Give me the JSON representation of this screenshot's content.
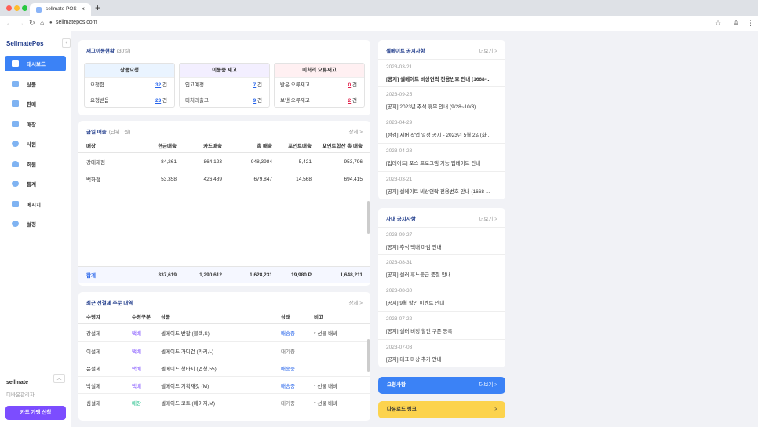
{
  "browser": {
    "tab_title": "sellmate POS",
    "url": "sellmatepos.com"
  },
  "sidebar": {
    "logo": "SellmatePos",
    "collapse_icon": "‹",
    "items": [
      {
        "label": "대시보드",
        "icon": "monitor-icon",
        "active": true
      },
      {
        "label": "상품",
        "icon": "box-icon"
      },
      {
        "label": "판매",
        "icon": "cart-icon"
      },
      {
        "label": "매장",
        "icon": "store-icon"
      },
      {
        "label": "사원",
        "icon": "employee-icon"
      },
      {
        "label": "회원",
        "icon": "member-icon"
      },
      {
        "label": "통계",
        "icon": "chart-icon"
      },
      {
        "label": "메시지",
        "icon": "mail-icon"
      },
      {
        "label": "설정",
        "icon": "gear-icon"
      }
    ],
    "user_name": "sellmate",
    "user_role": "디바운관리자",
    "card_button": "카드 가맹 신청"
  },
  "inventory": {
    "title": "재고이동현황",
    "sub": "(30일)",
    "boxes": [
      {
        "title": "상품요청",
        "rows": [
          {
            "label": "요청함",
            "value": "32",
            "unit": "건"
          },
          {
            "label": "요청받음",
            "value": "23",
            "unit": "건"
          }
        ]
      },
      {
        "title": "이동중 재고",
        "rows": [
          {
            "label": "입고예정",
            "value": "7",
            "unit": "건"
          },
          {
            "label": "미처리출고",
            "value": "9",
            "unit": "건"
          }
        ]
      },
      {
        "title": "미처리 오류재고",
        "rows": [
          {
            "label": "받은 오류재고",
            "value": "0",
            "unit": "건"
          },
          {
            "label": "보낸 오류재고",
            "value": "2",
            "unit": "건"
          }
        ]
      }
    ]
  },
  "sales": {
    "title": "금일 매출",
    "sub": "(단위 : 원)",
    "more": "상세 >",
    "headers": [
      "매장",
      "현금매출",
      "카드매출",
      "총 매출",
      "포인트매출",
      "포인트합산 총 매출"
    ],
    "rows": [
      [
        "강대제점",
        "84,261",
        "864,123",
        "948,3984",
        "5,421",
        "953,796"
      ],
      [
        "백화점",
        "53,358",
        "426,489",
        "679,847",
        "14,568",
        "694,415"
      ]
    ],
    "total": [
      "합계",
      "337,619",
      "1,290,612",
      "1,628,231",
      "19,980 P",
      "1,648,211"
    ]
  },
  "orders": {
    "title": "최근 선결제 주문 내역",
    "more": "상세 >",
    "headers": [
      "수령자",
      "수령구분",
      "상품",
      "상태",
      "비고"
    ],
    "rows": [
      [
        "강설제",
        "택배",
        "셀메이드 반팔 (블랙,S)",
        "배송중",
        "* 선물 배바"
      ],
      [
        "이설제",
        "택배",
        "셀메이드 가디건 (카키,L)",
        "대기중",
        ""
      ],
      [
        "문설제",
        "택배",
        "셀메이드 청바지 (연청,55)",
        "배송중",
        ""
      ],
      [
        "박설제",
        "택배",
        "셀메이드 기획재킷 (M)",
        "배송중",
        "* 선물 배바"
      ],
      [
        "심설제",
        "매장",
        "셀메이드 코트 (베이지,M)",
        "대기중",
        "* 선물 배바"
      ]
    ]
  },
  "notices": {
    "title": "셀메이트 공지사항",
    "more": "더보기 >",
    "items": [
      {
        "date": "2023-03-21",
        "text": "[공지] 셀메이트 비상연락 전용번호 안내 (1668-...",
        "bold": true
      },
      {
        "date": "2023-09-25",
        "text": "[공지] 2023년 추석 휴무 안내 (9/28~10/3)"
      },
      {
        "date": "2023-04-29",
        "text": "[점검] 서버 작업 일정 공지 - 2023년 5월 2일(화..."
      },
      {
        "date": "2023-04-28",
        "text": "[업데이트] 포스 프로그램 기능 업데이트 안내"
      },
      {
        "date": "2023-03-21",
        "text": "[공지] 셀메이트 비상연락 전용번호 안내 (1668-..."
      }
    ]
  },
  "internal": {
    "title": "사내 공지사항",
    "more": "더보기 >",
    "items": [
      {
        "date": "2023-09-27",
        "text": "[공지] 추석 택배 마감 안내"
      },
      {
        "date": "2023-08-31",
        "text": "[공지] 셀러 후느등급 품절 안내"
      },
      {
        "date": "2023-08-30",
        "text": "[공지] 9월 할인 이벤트 안내"
      },
      {
        "date": "2023-07-22",
        "text": "[공지] 셀러 비정 할인 쿠폰 등록"
      },
      {
        "date": "2023-07-03",
        "text": "[공지] 대표 마상 추가 안내"
      }
    ]
  },
  "help": {
    "label": "요청사항",
    "more": "더보기 >"
  },
  "download": {
    "label": "다운로드 링크",
    "more": ">"
  },
  "colors": {
    "primary": "#3b82f6",
    "purple": "#7c4dff",
    "link": "#2563eb",
    "red": "#e11d48",
    "yellow": "#fcd34d"
  }
}
